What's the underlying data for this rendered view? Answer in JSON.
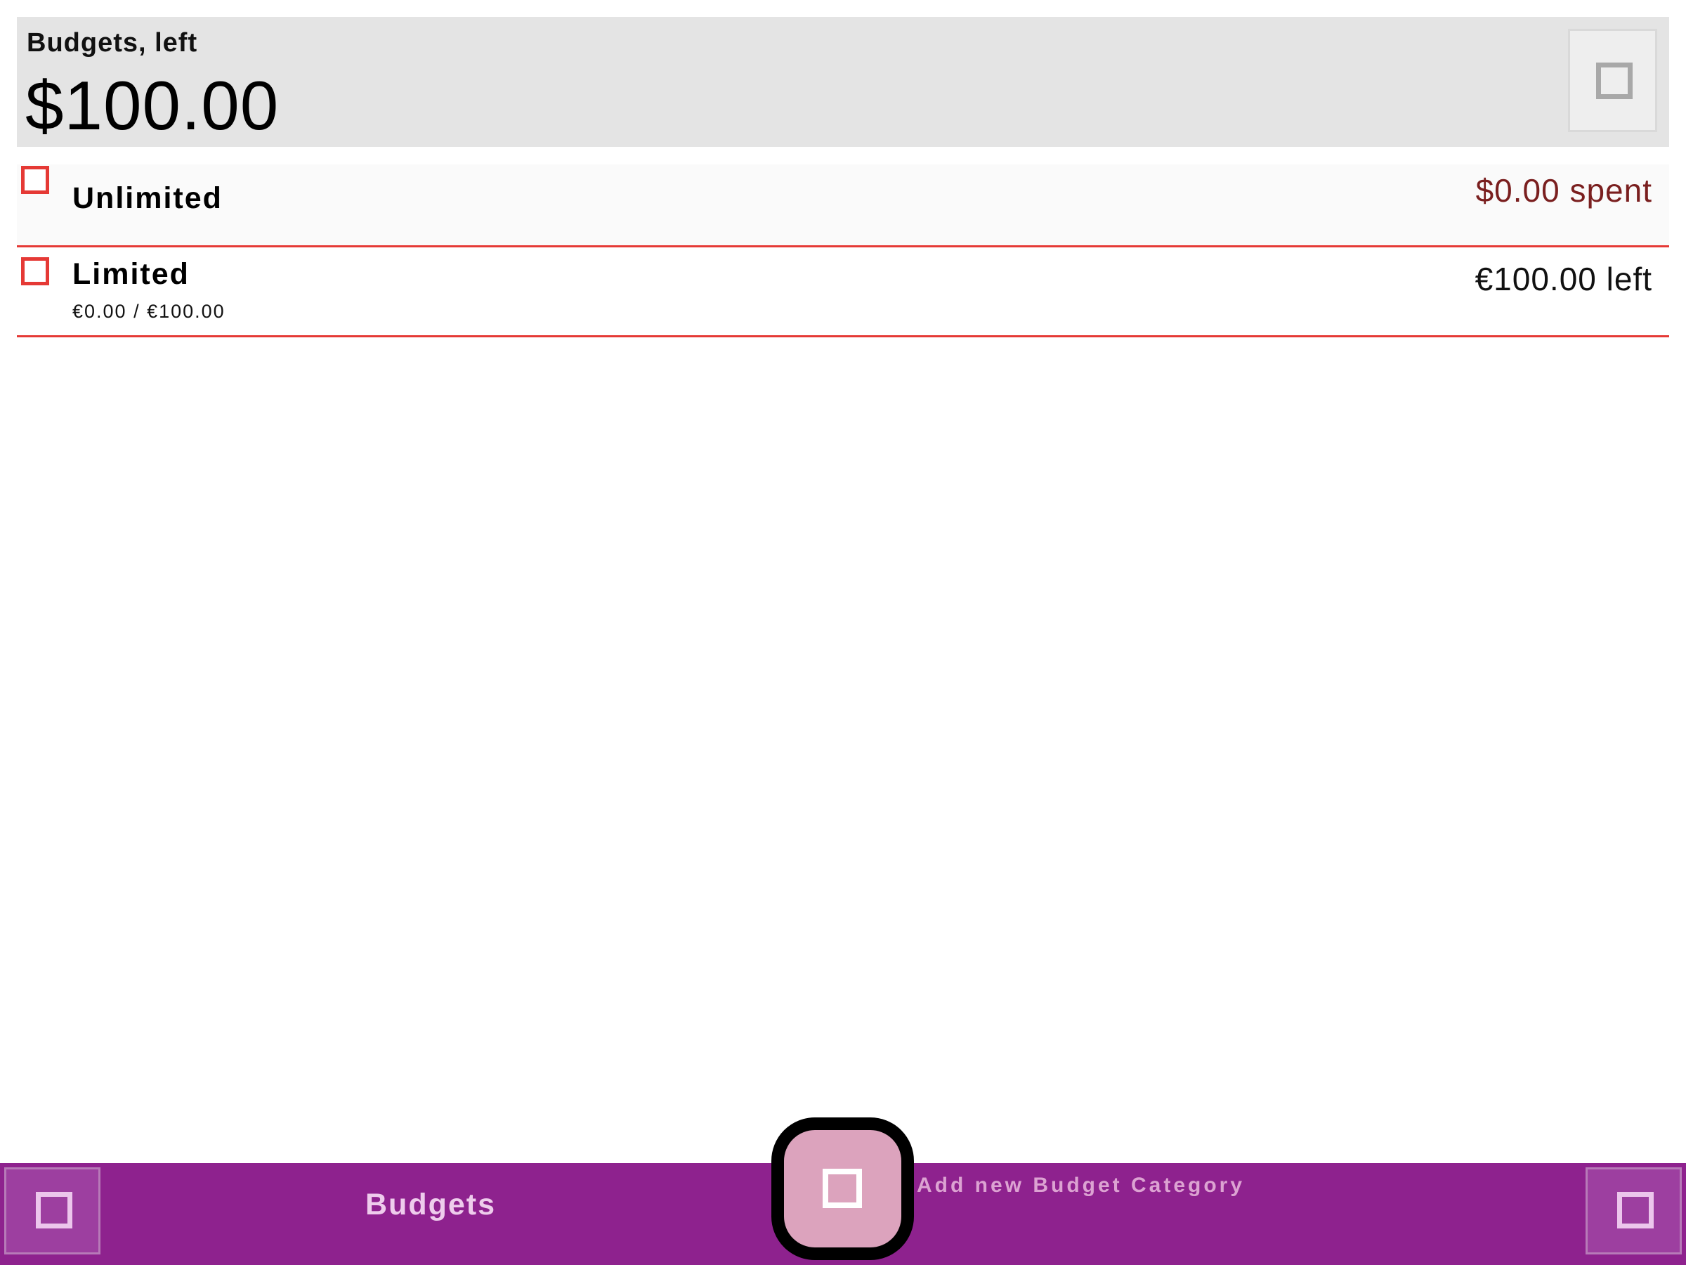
{
  "summary": {
    "label": "Budgets, left",
    "amount": "$100.00",
    "action_icon": "square-icon"
  },
  "categories": [
    {
      "name": "Unlimited",
      "right_text": "$0.00 spent",
      "icon": "category-square-icon"
    },
    {
      "name": "Limited",
      "subtitle": "€0.00 / €100.00",
      "right_text": "€100.00 left",
      "icon": "category-square-icon"
    }
  ],
  "bottom_bar": {
    "title": "Budgets",
    "left_icon": "menu-square-icon",
    "right_icon": "options-square-icon"
  },
  "fab": {
    "label": "Add new Budget Category",
    "icon": "add-square-icon"
  },
  "colors": {
    "accent": "#e53935",
    "bar": "#8e228e",
    "fab": "#dca3bd",
    "spent_text": "#7a1f1f"
  }
}
